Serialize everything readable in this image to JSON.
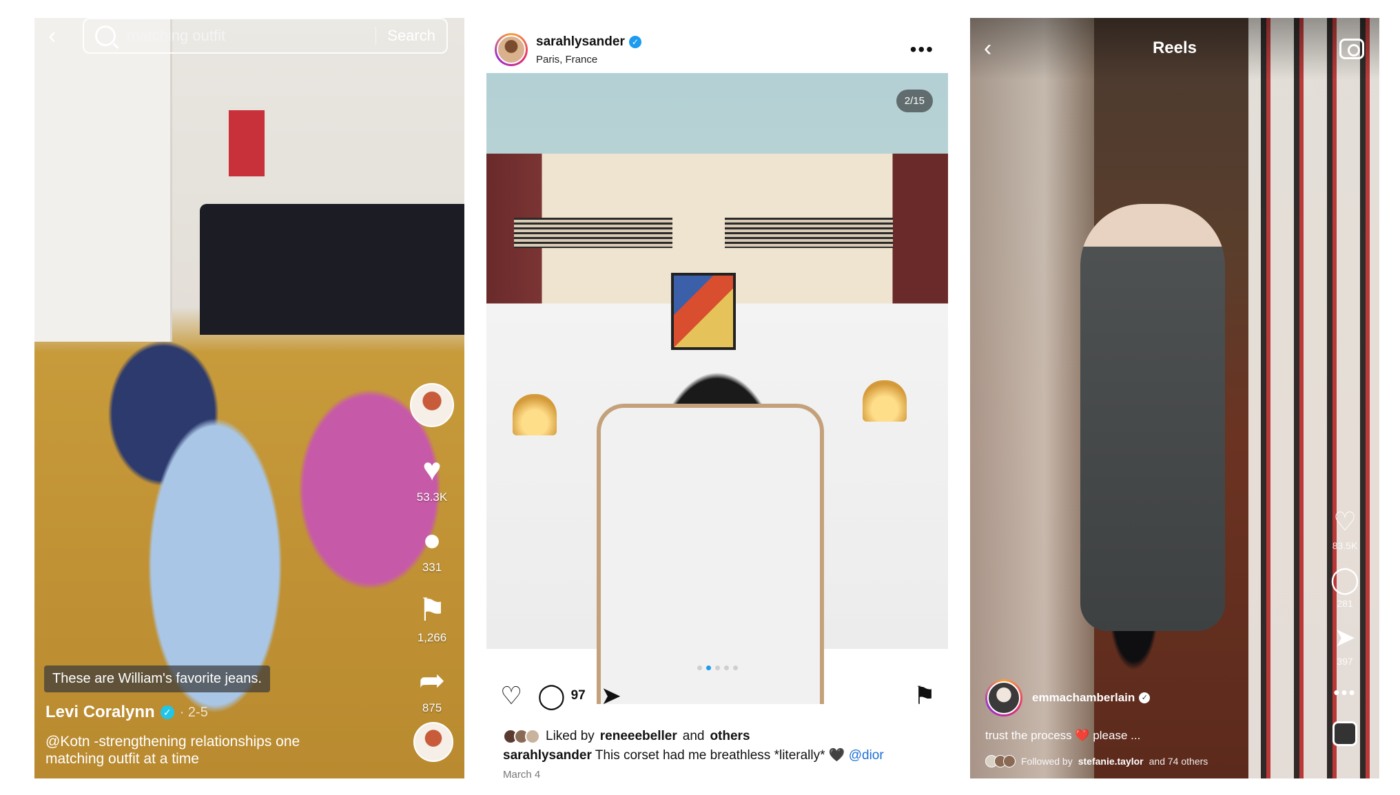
{
  "tiktok": {
    "search_query": "matching outfit",
    "search_button": "Search",
    "like_count": "53.3K",
    "comment_count": "331",
    "save_count": "1,266",
    "share_count": "875",
    "overlay_caption": "These are William's favorite jeans.",
    "author": "Levi Coralynn",
    "date": "· 2-5",
    "description": "@Kotn -strengthening relationships one matching outfit at a time"
  },
  "instagram_post": {
    "username": "sarahlysander",
    "location": "Paris, France",
    "pager": "2/15",
    "comment_count": "97",
    "liked_by_prefix": "Liked by",
    "liked_by_user": "reneeebeller",
    "liked_by_and": "and",
    "liked_by_others": "others",
    "caption_user": "sarahlysander",
    "caption_text": "This corset had me breathless *literally* 🖤",
    "caption_mention": "@dior",
    "date": "March 4"
  },
  "reels": {
    "title": "Reels",
    "like_count": "83.5K",
    "comment_count": "281",
    "share_count": "397",
    "username": "emmachamberlain",
    "caption_text": "trust the process",
    "caption_heart": "❤️",
    "caption_more": "please ...",
    "followed_prefix": "Followed by",
    "followed_user": "stefanie.taylor",
    "followed_suffix": "and 74 others"
  },
  "colors": {
    "ig_blue": "#1d9bf0",
    "tiktok_verified": "#20c5e8",
    "heart_red": "#e0323a"
  }
}
